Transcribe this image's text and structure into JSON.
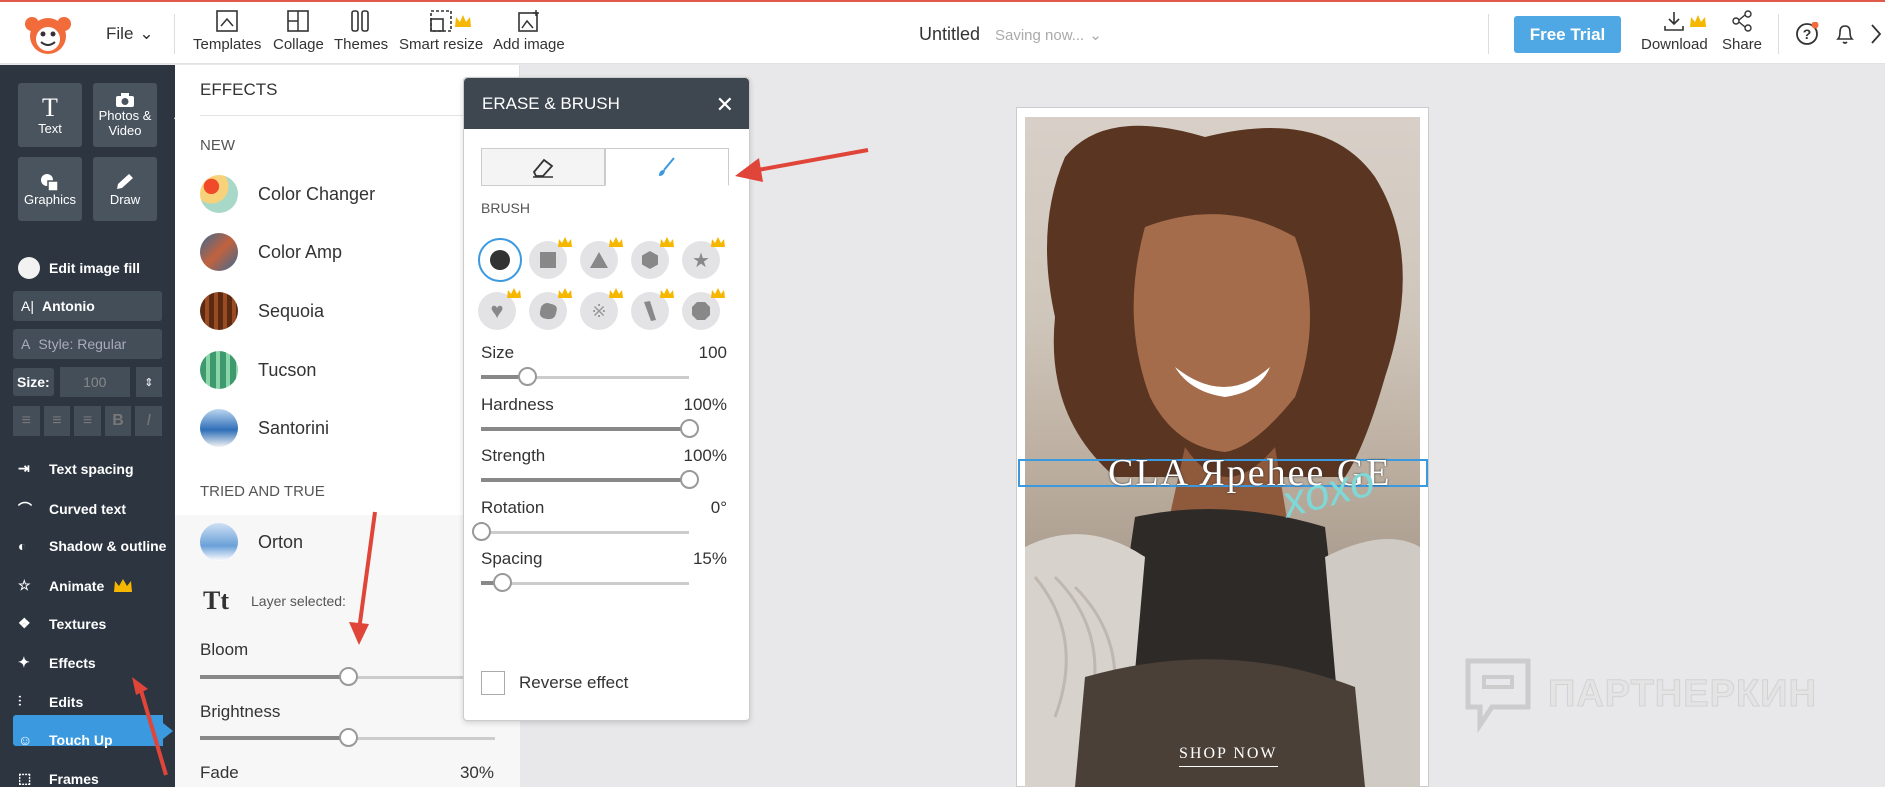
{
  "topbar": {
    "file_label": "File",
    "tools": [
      {
        "label": "Templates",
        "icon": "templates-icon"
      },
      {
        "label": "Collage",
        "icon": "collage-icon"
      },
      {
        "label": "Themes",
        "icon": "themes-icon"
      },
      {
        "label": "Smart resize",
        "icon": "smart-resize-icon"
      },
      {
        "label": "Add image",
        "icon": "add-image-icon"
      }
    ],
    "doc_title": "Untitled",
    "saving": "Saving now...",
    "free_trial": "Free Trial",
    "download": "Download",
    "share": "Share"
  },
  "leftnav": {
    "tiles": [
      {
        "label": "Text"
      },
      {
        "label": "Photos & Video"
      },
      {
        "label": "Graphics"
      },
      {
        "label": "Draw"
      }
    ],
    "edit_fill": "Edit image fill",
    "font": "Antonio",
    "style": "Style: Regular",
    "size_label": "Size:",
    "size_placeholder": "100",
    "items": [
      {
        "label": "Text spacing"
      },
      {
        "label": "Curved text"
      },
      {
        "label": "Shadow & outline"
      },
      {
        "label": "Animate"
      },
      {
        "label": "Textures"
      },
      {
        "label": "Effects"
      },
      {
        "label": "Edits"
      },
      {
        "label": "Touch Up"
      },
      {
        "label": "Frames"
      }
    ]
  },
  "effects_panel": {
    "title": "EFFECTS",
    "new_label": "NEW",
    "new_items": [
      {
        "label": "Color Changer",
        "color": "#f2c48a"
      },
      {
        "label": "Color Amp",
        "color": "#c2623e"
      },
      {
        "label": "Sequoia",
        "color": "#7a3b1e"
      },
      {
        "label": "Tucson",
        "color": "#5fb38a"
      },
      {
        "label": "Santorini",
        "color": "#7fa8d6"
      }
    ],
    "tried_label": "TRIED AND TRUE",
    "orton": "Orton",
    "layer_selected": "Layer selected:",
    "sliders": [
      {
        "label": "Bloom",
        "value": ""
      },
      {
        "label": "Brightness",
        "value": ""
      },
      {
        "label": "Fade",
        "value": "30%"
      }
    ]
  },
  "erase_brush": {
    "title": "ERASE & BRUSH",
    "brush_label": "BRUSH",
    "sliders": [
      {
        "label": "Size",
        "value": "100",
        "level": 0.22
      },
      {
        "label": "Hardness",
        "value": "100%",
        "level": 1
      },
      {
        "label": "Strength",
        "value": "100%",
        "level": 1
      },
      {
        "label": "Rotation",
        "value": "0°",
        "level": 0
      },
      {
        "label": "Spacing",
        "value": "15%",
        "level": 0.1
      }
    ],
    "reverse": "Reverse effect"
  },
  "canvas": {
    "headline": "CLA Яреhеe GE",
    "xoxo": "xoxo",
    "shop_now": "SHOP NOW",
    "watermark": "ПАРТНЕРКИН"
  },
  "colors": {
    "accent": "#3b99e0",
    "nav": "#2c3540",
    "trial": "#4fa8e3",
    "arrow": "#e0453a"
  }
}
